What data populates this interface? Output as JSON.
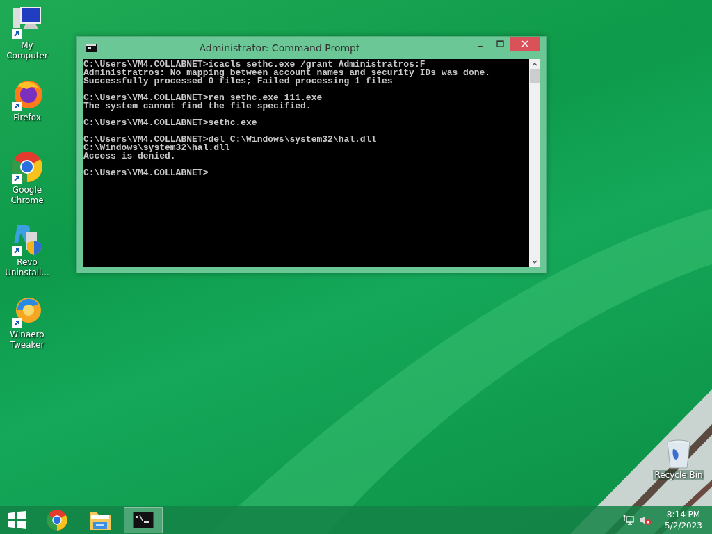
{
  "desktop_icons": [
    {
      "label": "My Computer",
      "kind": "computer"
    },
    {
      "label": "Firefox",
      "kind": "firefox"
    },
    {
      "label": "Google Chrome",
      "kind": "chrome"
    },
    {
      "label": "Revo Uninstall...",
      "kind": "revo"
    },
    {
      "label": "Winaero Tweaker",
      "kind": "winaero"
    }
  ],
  "recycle_bin": {
    "label": "Recycle Bin"
  },
  "window": {
    "title": "Administrator: Command Prompt",
    "blocks": [
      [
        "C:\\Users\\VM4.COLLABNET>icacls sethc.exe /grant Administratros:F",
        "Administratros: No mapping between account names and security IDs was done.",
        "Successfully processed 0 files; Failed processing 1 files"
      ],
      [
        "C:\\Users\\VM4.COLLABNET>ren sethc.exe 111.exe",
        "The system cannot find the file specified."
      ],
      [
        "C:\\Users\\VM4.COLLABNET>sethc.exe"
      ],
      [
        "C:\\Users\\VM4.COLLABNET>del C:\\Windows\\system32\\hal.dll",
        "C:\\Windows\\system32\\hal.dll",
        "Access is denied."
      ],
      [
        "C:\\Users\\VM4.COLLABNET>"
      ]
    ]
  },
  "taskbar": {
    "apps": [
      {
        "kind": "chrome",
        "selected": false
      },
      {
        "kind": "explorer",
        "selected": false
      },
      {
        "kind": "console",
        "selected": true
      }
    ],
    "clock": {
      "time": "8:14 PM",
      "date": "5/2/2023"
    }
  }
}
